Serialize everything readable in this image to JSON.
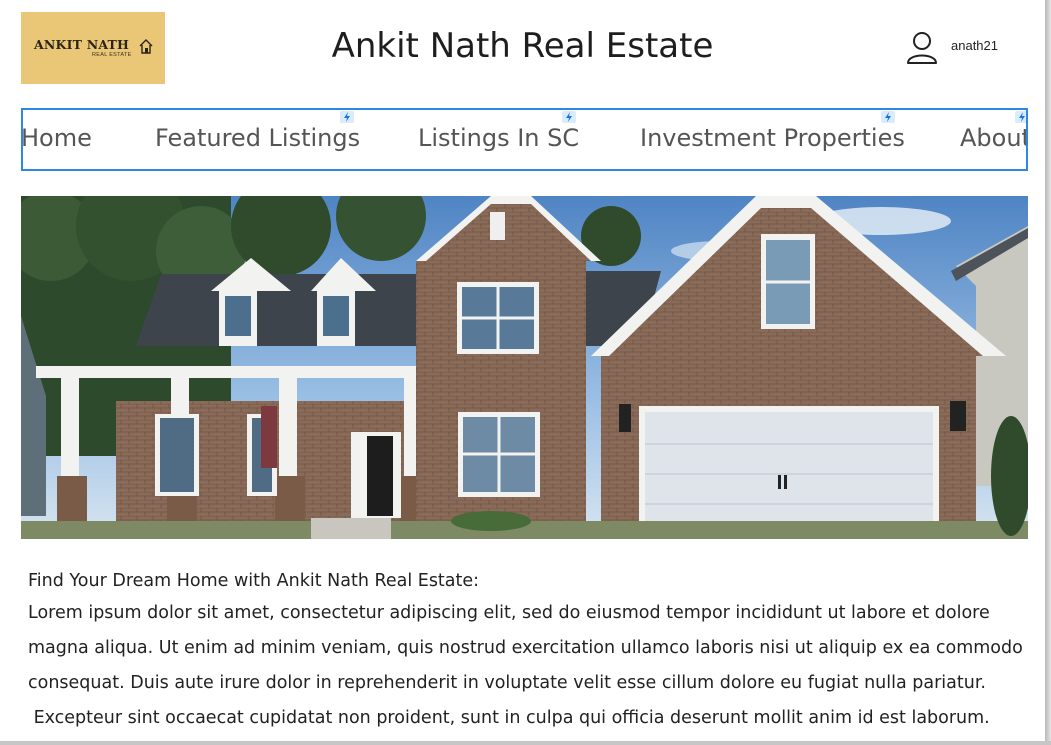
{
  "logo": {
    "main": "ANKIT NATH",
    "sub": "REAL ESTATE",
    "color": "#eac776"
  },
  "header": {
    "title": "Ankit Nath Real Estate",
    "username": "anath21",
    "user_icon": "user-icon"
  },
  "nav": {
    "border_color": "#2f86e4",
    "items": [
      {
        "label": "Home"
      },
      {
        "label": "Featured Listings"
      },
      {
        "label": "Listings In SC"
      },
      {
        "label": "Investment Properties"
      },
      {
        "label": "About"
      }
    ],
    "badge_icon": "lightning-bolt-icon"
  },
  "hero": {
    "alt": "Brick two-story house with white garage door"
  },
  "content": {
    "intro": "Find Your Dream Home with Ankit Nath Real Estate:",
    "lines": [
      "Lorem ipsum dolor sit amet, consectetur adipiscing elit, sed do eiusmod tempor incididunt ut labore et dolore",
      "magna aliqua. Ut enim ad minim veniam, quis nostrud exercitation ullamco laboris nisi ut aliquip ex ea commodo",
      "consequat. Duis aute irure dolor in reprehenderit in voluptate velit esse cillum dolore eu fugiat nulla pariatur.",
      " Excepteur sint occaecat cupidatat non proident, sunt in culpa qui officia deserunt mollit anim id est laborum."
    ]
  }
}
